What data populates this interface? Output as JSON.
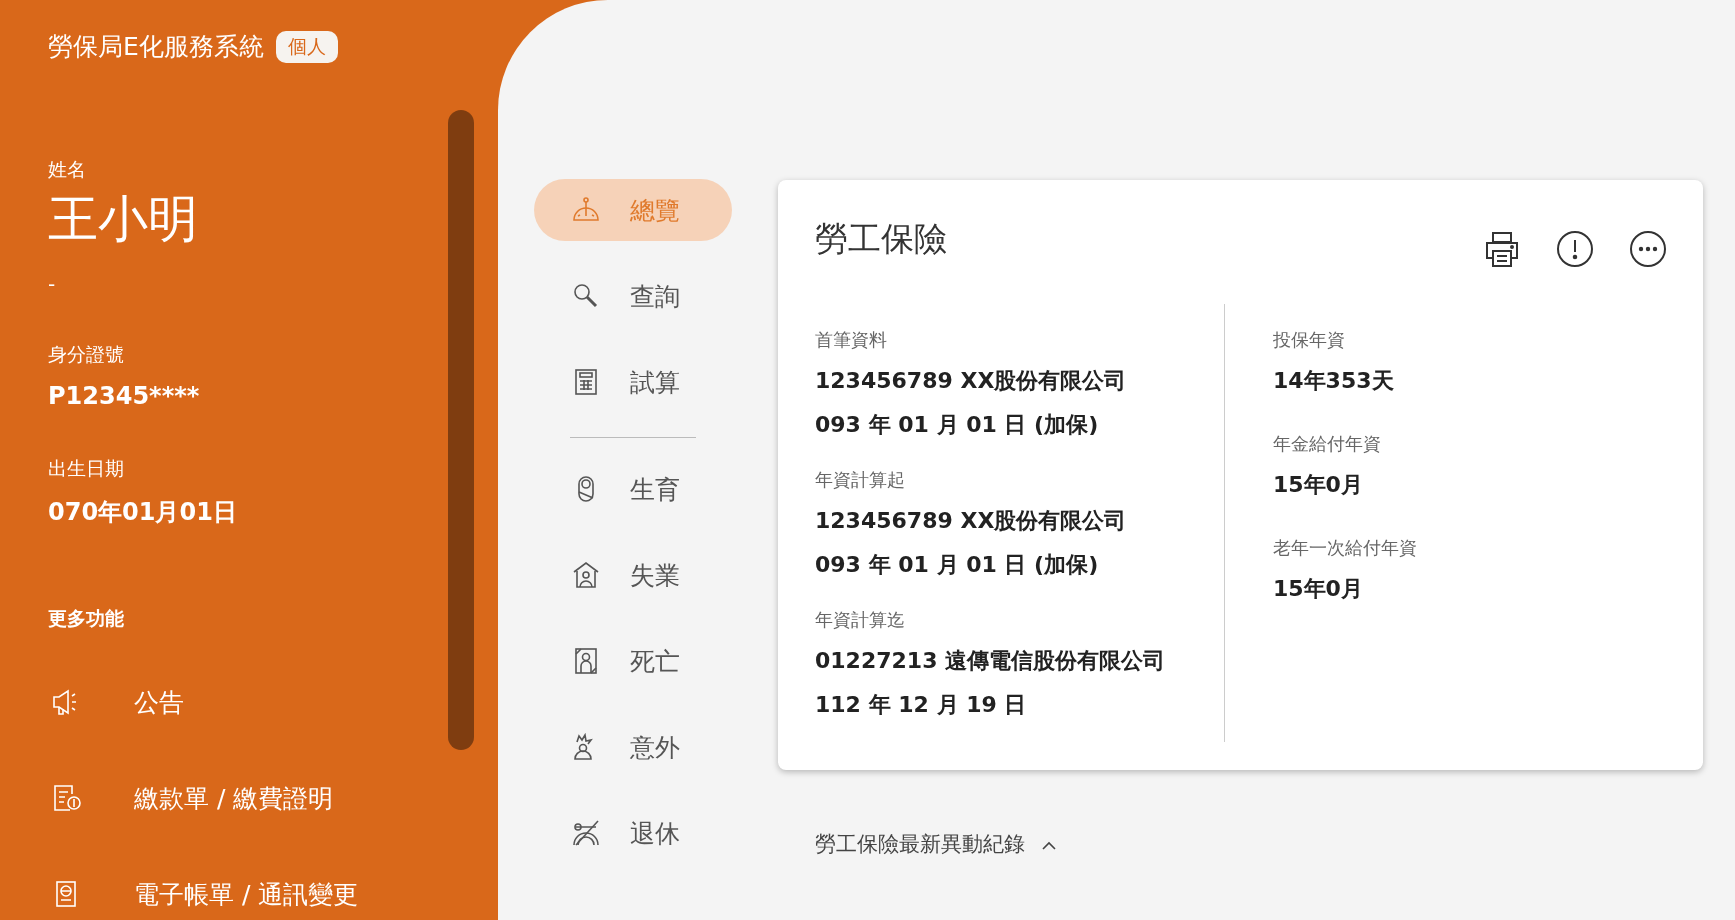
{
  "app_title": "勞保局E化服務系統",
  "badge": "個人",
  "profile": {
    "name_label": "姓名",
    "name": "王小明",
    "name_note": "-",
    "fields": [
      {
        "label": "身分證號",
        "value": "P12345****"
      },
      {
        "label": "出生日期",
        "value": "070年01月01日"
      }
    ]
  },
  "more": {
    "heading": "更多功能",
    "items": [
      {
        "label": "公告"
      },
      {
        "label": "繳款單 / 繳費證明"
      },
      {
        "label": "電子帳單 / 通訊變更"
      }
    ]
  },
  "nav": {
    "groups": [
      [
        {
          "label": "總覽",
          "selected": true
        },
        {
          "label": "查詢",
          "selected": false
        },
        {
          "label": "試算",
          "selected": false
        }
      ],
      [
        {
          "label": "生育",
          "selected": false
        },
        {
          "label": "失業",
          "selected": false
        },
        {
          "label": "死亡",
          "selected": false
        },
        {
          "label": "意外",
          "selected": false
        },
        {
          "label": "退休",
          "selected": false
        }
      ]
    ]
  },
  "card": {
    "title": "勞工保險",
    "left": [
      {
        "label": "首筆資料",
        "lines": [
          "123456789 XX股份有限公司",
          "093 年 01 月 01 日 (加保)"
        ]
      },
      {
        "label": "年資計算起",
        "lines": [
          "123456789 XX股份有限公司",
          "093 年 01 月 01 日 (加保)"
        ]
      },
      {
        "label": "年資計算迄",
        "lines": [
          "01227213 遠傳電信股份有限公司",
          "112 年 12 月 19 日"
        ]
      }
    ],
    "right": [
      {
        "label": "投保年資",
        "value": "14年353天"
      },
      {
        "label": "年金給付年資",
        "value": "15年0月"
      },
      {
        "label": "老年一次給付年資",
        "value": "15年0月"
      }
    ]
  },
  "footer_link": "勞工保險最新異動紀錄"
}
